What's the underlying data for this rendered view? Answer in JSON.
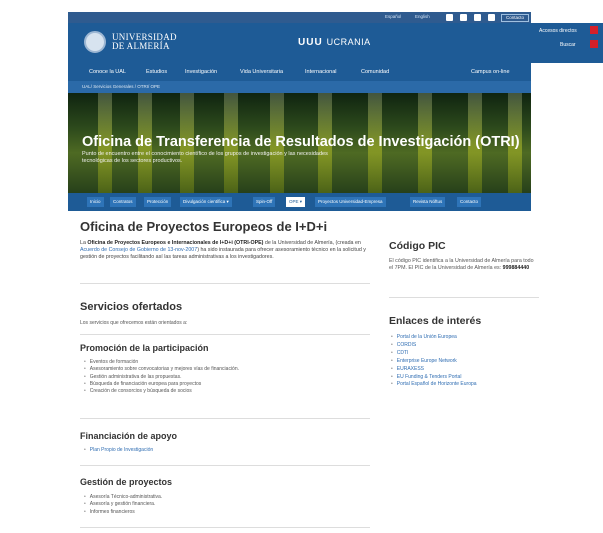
{
  "topbar": {
    "lang_es": "Español",
    "lang_en": "English",
    "contact": "Contacto"
  },
  "header": {
    "university_line1": "UNIVERSIDAD",
    "university_line2": "DE ALMERÍA",
    "ukraine_mark": "UUU",
    "ukraine_text": "UCRANIA",
    "access_button": "Accesos directos",
    "search_button": "Buscar"
  },
  "nav": {
    "items": [
      "Conoce la UAL",
      "Estudios",
      "Investigación",
      "Vida Universitaria",
      "Internacional",
      "Comunidad",
      "Campus on-line"
    ]
  },
  "breadcrumb": "UAL/ Servicios Generales / OTRI/ OPE",
  "hero": {
    "title": "Oficina de Transferencia de Resultados de Investigación (OTRI)",
    "subtitle": "Punto de encuentro entre el conocimiento científico de los grupos de investigación y las necesidades tecnológicas de los sectores productivos."
  },
  "tabs": [
    "Inicio",
    "Contratos",
    "Protección",
    "Divulgación científica ▾",
    "Spin-Off",
    "OPE ▾",
    "Proyectos Universidad-Empresa",
    "Revista Nóftus",
    "Contacto"
  ],
  "main": {
    "title": "Oficina de Proyectos Europeos de I+D+i",
    "intro_pre": "La ",
    "intro_bold": "Oficina de Proyectos Europeos e Internacionales de I+D+i (OTRI-OPE)",
    "intro_mid": " de la Universidad de Almería, (creada en ",
    "intro_link": "Acuerdo de Consejo de Gobierno de 13-nov-2007",
    "intro_post": ") ha sido instaurada para ofrecer asesoramiento técnico en la solicitud y gestión de proyectos facilitando así las tareas administrativas a los investigadores.",
    "services_title": "Servicios ofertados",
    "services_text": "Los servicios que ofrecemos están orientados a:",
    "promo_title": "Promoción de la participación",
    "promo_items": [
      "Eventos de formación",
      "Asesoramiento sobre convocatorias y mejores vías de financiación.",
      "Gestión administrativa de las propuestas.",
      "Búsqueda de financiación europea para proyectos",
      "Creación de consorcios y búsqueda de socios"
    ],
    "funding_title": "Financiación de apoyo",
    "funding_items": [
      "Plan Propio de Investigación"
    ],
    "mgmt_title": "Gestión de proyectos",
    "mgmt_items": [
      "Asesoría Técnico-administrativa.",
      "Asesoría y gestión financiera.",
      "Informes financieros"
    ]
  },
  "aside": {
    "pic_title": "Código PIC",
    "pic_text": "El código PIC identifica a la Universidad de Almería para todo el 7PM. El PIC de la Universidad de Almería es: ",
    "pic_code": "999884440",
    "links_title": "Enlaces de interés",
    "links": [
      "Portal de la Unión Europea",
      "CORDIS",
      "CDTI",
      "Enterprise Europe Network",
      "EURAXESS",
      "EU Funding & Tenders Portal",
      "Portal Español de Horizonte Europa"
    ]
  },
  "colors": {
    "header_blue": "#1e5b96",
    "tab_blue": "#2e74b8",
    "link_blue": "#2f6db2",
    "accent_red": "#d4202a"
  }
}
